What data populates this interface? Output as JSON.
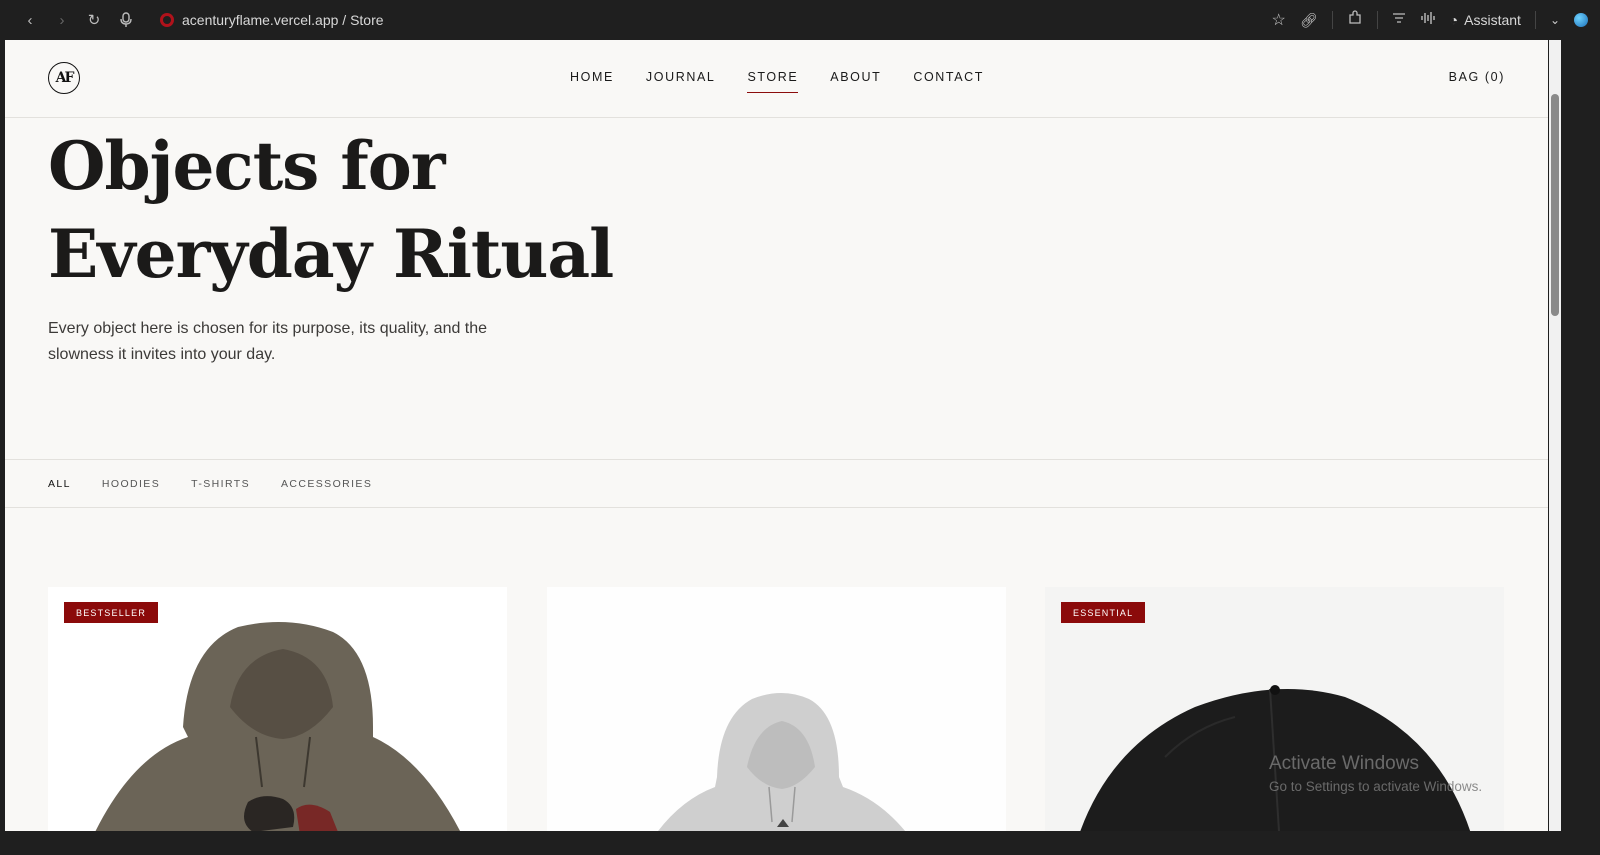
{
  "browser": {
    "url_text": "acenturyflame.vercel.app / Store",
    "assistant_label": "Assistant"
  },
  "site": {
    "logo_text": "AF",
    "nav": [
      {
        "label": "HOME"
      },
      {
        "label": "JOURNAL"
      },
      {
        "label": "STORE",
        "active": true
      },
      {
        "label": "ABOUT"
      },
      {
        "label": "CONTACT"
      }
    ],
    "bag_label": "BAG (0)"
  },
  "hero": {
    "title_line1": "Objects for",
    "title_line2": "Everyday Ritual",
    "subtitle": "Every object here is chosen for its purpose, its quality, and the slowness it invites into your day."
  },
  "filters": [
    {
      "label": "ALL",
      "active": true
    },
    {
      "label": "HOODIES"
    },
    {
      "label": "T-SHIRTS"
    },
    {
      "label": "ACCESSORIES"
    }
  ],
  "products": [
    {
      "badge": "BESTSELLER",
      "image": "olive-hoodie"
    },
    {
      "badge": "",
      "image": "grey-hoodie"
    },
    {
      "badge": "ESSENTIAL",
      "image": "black-cap"
    }
  ],
  "overlay": {
    "line1": "Activate Windows",
    "line2": "Go to Settings to activate Windows."
  },
  "colors": {
    "accent": "#8b0a0a",
    "page_bg": "#f9f8f6",
    "text": "#1b1a19"
  }
}
